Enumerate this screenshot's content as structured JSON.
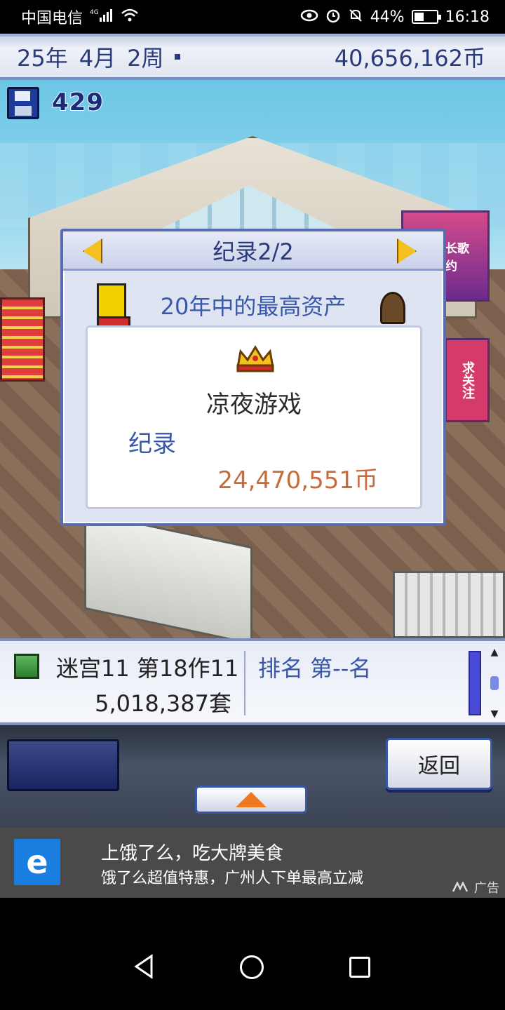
{
  "status_bar": {
    "carrier": "中国电信",
    "network": "4G",
    "battery_percent": "44%",
    "battery_level": 0.44,
    "time": "16:18"
  },
  "top_bar": {
    "year": "25年",
    "month": "4月",
    "week": "2周",
    "money": "40,656,162币"
  },
  "scene": {
    "save_count": "429"
  },
  "dialog": {
    "title": "纪录2/2",
    "category": "20年中的最高资产",
    "company": "凉夜游戏",
    "record_label": "纪录",
    "record_value": "24,470,551币"
  },
  "info_panel": {
    "game_title": "迷宫11 第18作11",
    "sales": "5,018,387套",
    "ranking": "排名 第--名"
  },
  "controls": {
    "back_label": "返回"
  },
  "ad": {
    "logo": "e",
    "title": "上饿了么，吃大牌美食",
    "desc": "饿了么超值特惠，广州人下单最高立减",
    "tag": "广告"
  },
  "colors": {
    "accent": "#3a58a8",
    "value": "#c86a3a"
  }
}
